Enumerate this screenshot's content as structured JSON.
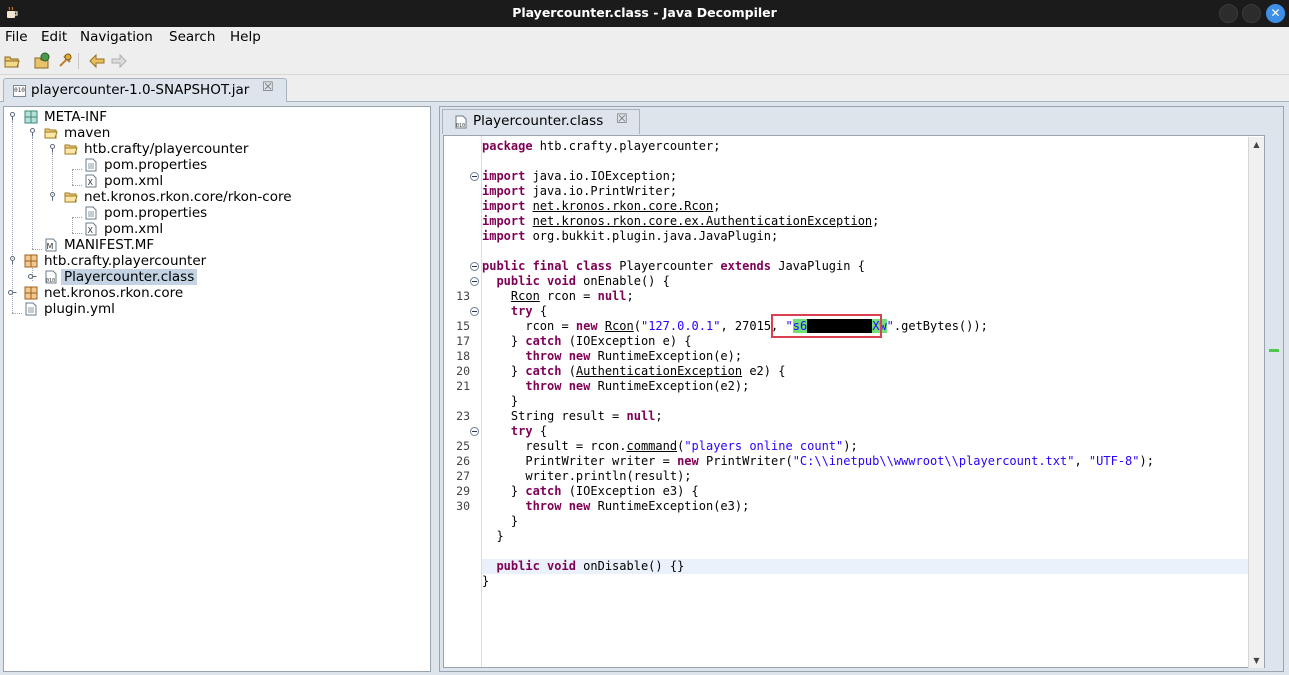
{
  "window": {
    "title": "Playercounter.class - Java Decompiler"
  },
  "menu": [
    "File",
    "Edit",
    "Navigation",
    "Search",
    "Help"
  ],
  "toolbar": {
    "icons": [
      "open-file-icon",
      "open-type-icon",
      "search-icon",
      "back-icon",
      "forward-icon"
    ]
  },
  "jar_tab": {
    "label": "playercounter-1.0-SNAPSHOT.jar",
    "close": "☒",
    "icon_text": "010"
  },
  "tree": {
    "nodes": [
      {
        "label": "META-INF"
      },
      {
        "label": "maven"
      },
      {
        "label": "htb.crafty/playercounter"
      },
      {
        "label": "pom.properties"
      },
      {
        "label": "pom.xml"
      },
      {
        "label": "net.kronos.rkon.core/rkon-core"
      },
      {
        "label": "pom.properties"
      },
      {
        "label": "pom.xml"
      },
      {
        "label": "MANIFEST.MF"
      },
      {
        "label": "htb.crafty.playercounter"
      },
      {
        "label": "Playercounter.class"
      },
      {
        "label": "net.kronos.rkon.core"
      },
      {
        "label": "plugin.yml"
      }
    ]
  },
  "editor_tab": {
    "label": "Playercounter.class",
    "close": "☒"
  },
  "code": {
    "line_numbers": [
      "13",
      "15",
      "17",
      "18",
      "20",
      "21",
      "23",
      "25",
      "26",
      "27",
      "29",
      "30"
    ],
    "secret_visible_start": "s6",
    "secret_visible_end": "Xw",
    "lines": [
      "package htb.crafty.playercounter;",
      "import java.io.IOException;",
      "import java.io.PrintWriter;",
      "import net.kronos.rkon.core.Rcon;",
      "import net.kronos.rkon.core.ex.AuthenticationException;",
      "import org.bukkit.plugin.java.JavaPlugin;",
      "public final class Playercounter extends JavaPlugin {",
      "  public void onEnable() {",
      "    Rcon rcon = null;",
      "    try {",
      "      rcon = new Rcon(\"127.0.0.1\", 27015, \"",
      "\".getBytes());",
      "    } catch (IOException e) {",
      "      throw new RuntimeException(e);",
      "    } catch (AuthenticationException e2) {",
      "      throw new RuntimeException(e2);",
      "    }",
      "    String result = null;",
      "    try {",
      "      result = rcon.command(\"players online count\");",
      "      PrintWriter writer = new PrintWriter(\"C:\\\\inetpub\\\\wwwroot\\\\playercount.txt\", \"UTF-8\");",
      "      writer.println(result);",
      "    } catch (IOException e3) {",
      "      throw new RuntimeException(e3);",
      "    }",
      "  }",
      "  public void onDisable() {}",
      "}"
    ]
  },
  "colors": {
    "keyword": "#7f0055",
    "string": "#2a00ff",
    "highlight_box": "#d94050",
    "selection": "#c4d3e4",
    "titlebar": "#1b1b1b"
  }
}
